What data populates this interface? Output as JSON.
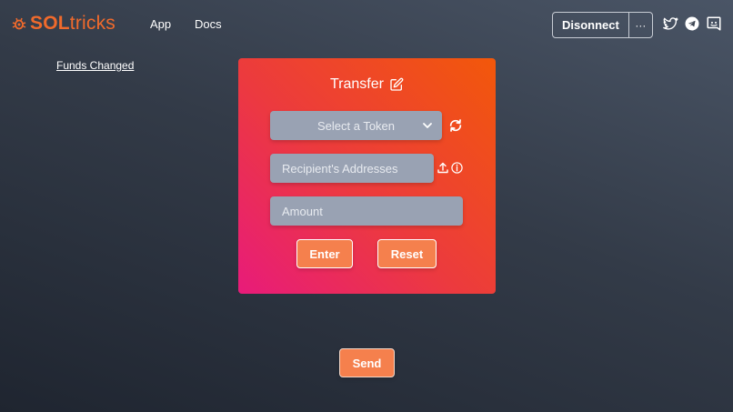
{
  "header": {
    "logo": {
      "bold": "SOL",
      "light": "tricks",
      "icon": "bug-icon"
    },
    "nav": [
      {
        "label": "App"
      },
      {
        "label": "Docs"
      }
    ],
    "wallet": {
      "disconnect_label": "Disonnect",
      "more_label": "···"
    },
    "social": [
      "twitter-icon",
      "telegram-icon",
      "discord-icon"
    ]
  },
  "funds_link": "Funds Changed",
  "transfer_card": {
    "title": "Transfer",
    "token_select": {
      "placeholder": "Select a Token"
    },
    "recipients": {
      "placeholder": "Recipient's Addresses",
      "value": ""
    },
    "amount": {
      "placeholder": "Amount",
      "value": ""
    },
    "enter_label": "Enter",
    "reset_label": "Reset"
  },
  "send_label": "Send",
  "colors": {
    "brand_orange": "#f06a2c",
    "button": "#f5804d",
    "field": "#99a2b3",
    "card_gradient_start": "#e81b7a",
    "card_gradient_end": "#f2580a"
  }
}
